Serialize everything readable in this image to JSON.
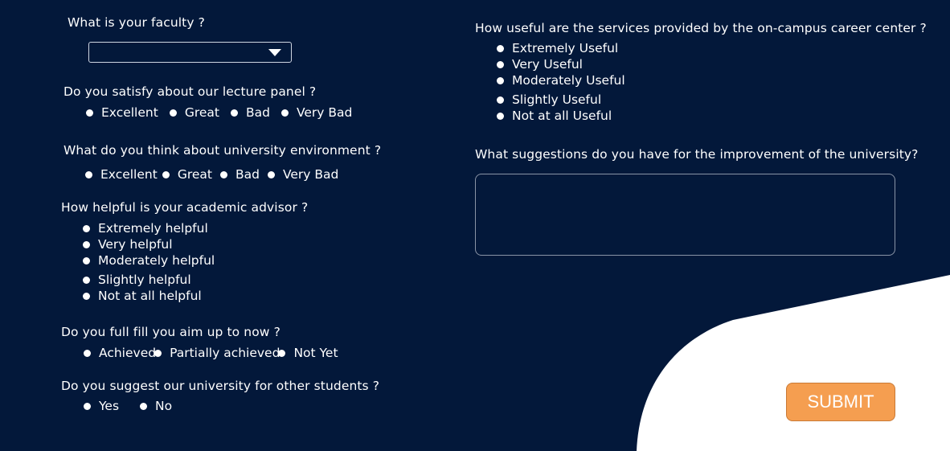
{
  "colors": {
    "background": "#03183a",
    "submit": "#f59e50",
    "curve": "#ffffff"
  },
  "faculty": {
    "question": "What is your faculty ?",
    "selected": ""
  },
  "lecture_panel": {
    "question": "Do you satisfy about our lecture panel ?",
    "options": [
      "Excellent",
      "Great",
      "Bad",
      "Very Bad"
    ]
  },
  "environment": {
    "question": "What do you think about university environment ?",
    "options": [
      "Excellent",
      "Great",
      "Bad",
      "Very Bad"
    ]
  },
  "advisor": {
    "question": "How helpful is your academic advisor ?",
    "options": [
      "Extremely helpful",
      "Very helpful",
      "Moderately helpful",
      "Slightly helpful",
      "Not at all helpful"
    ]
  },
  "aim": {
    "question": "Do you full fill you aim up to now ?",
    "options": [
      "Achieved",
      "Partially achieved",
      "Not Yet"
    ]
  },
  "suggest": {
    "question": "Do you suggest our university for other students ?",
    "options": [
      "Yes",
      "No"
    ]
  },
  "career": {
    "question": "How useful are the services provided by the on-campus career center ?",
    "options": [
      "Extremely Useful",
      "Very Useful",
      "Moderately Useful",
      "Slightly Useful",
      "Not at all Useful"
    ]
  },
  "improvement": {
    "question": "What suggestions do you have for the improvement of the university?",
    "value": ""
  },
  "submit": {
    "label": "SUBMIT"
  }
}
